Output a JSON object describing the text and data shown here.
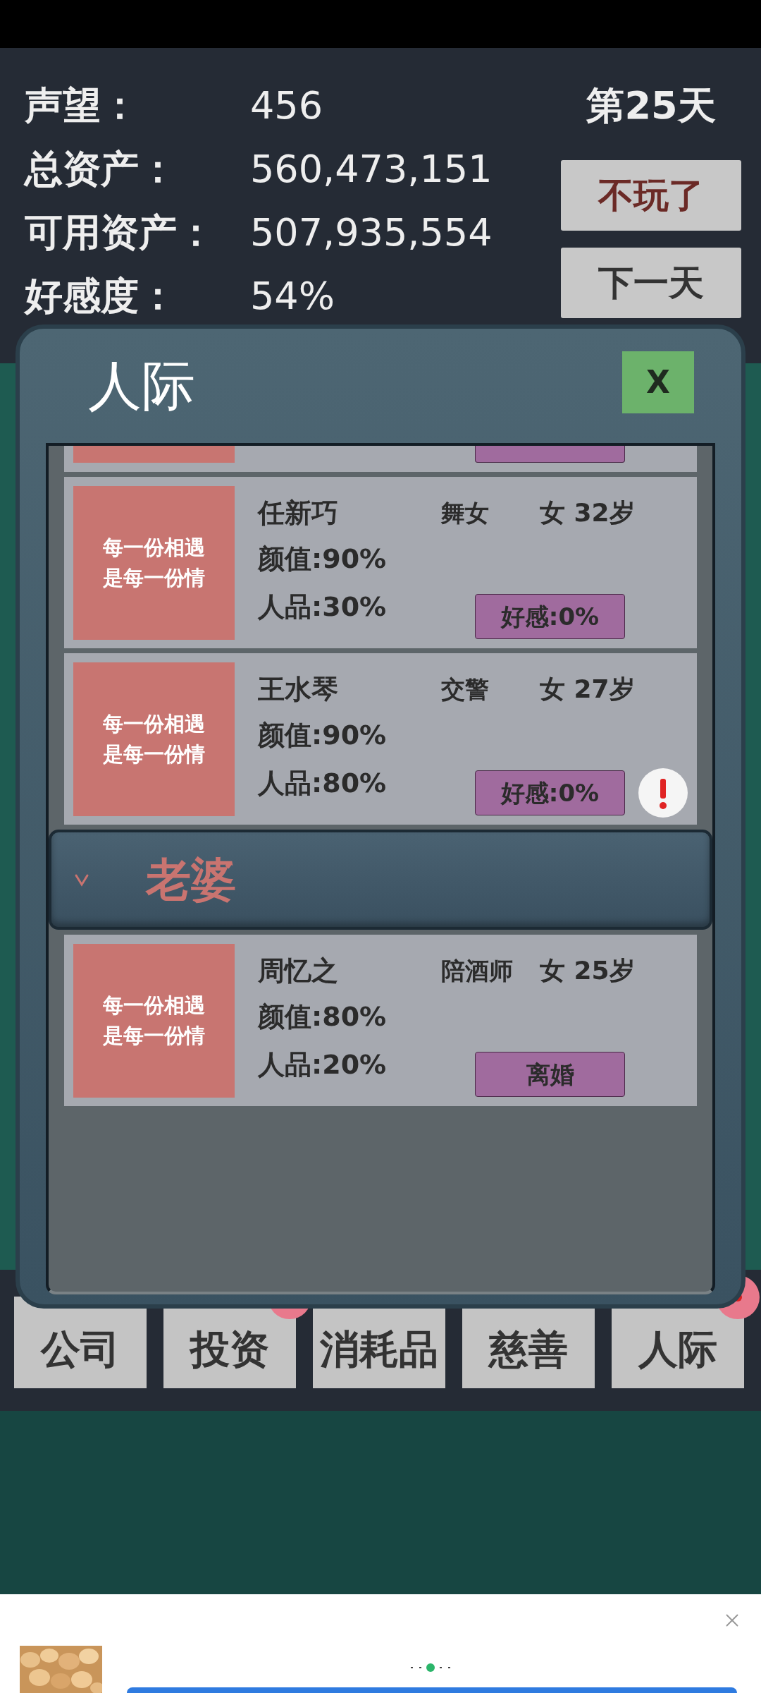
{
  "header": {
    "stats": [
      {
        "label": "声望：",
        "value": "456"
      },
      {
        "label": "总资产：",
        "value": "560,473,151"
      },
      {
        "label": "可用资产：",
        "value": "507,935,554"
      },
      {
        "label": "好感度：",
        "value": "54%"
      }
    ],
    "day": "第25天",
    "buttons": [
      {
        "label": "不玩了",
        "kind": "danger"
      },
      {
        "label": "下一天",
        "kind": "normal"
      }
    ]
  },
  "dialog": {
    "title": "人际",
    "close": "X",
    "entries": [
      {
        "kind": "partial"
      },
      {
        "kind": "card",
        "avatar_lines": [
          "每一份相遇",
          "是每一份情"
        ],
        "name": "任新巧",
        "job": "舞女",
        "gender_age": "女 32岁",
        "stats": [
          "颜值:90%",
          "人品:30%"
        ],
        "action": "好感:0%",
        "alert": false
      },
      {
        "kind": "card",
        "avatar_lines": [
          "每一份相遇",
          "是每一份情"
        ],
        "name": "王水琴",
        "job": "交警",
        "gender_age": "女 27岁",
        "stats": [
          "颜值:90%",
          "人品:80%"
        ],
        "action": "好感:0%",
        "alert": true
      },
      {
        "kind": "group",
        "label": "老婆",
        "expanded": true
      },
      {
        "kind": "card",
        "avatar_lines": [
          "每一份相遇",
          "是每一份情"
        ],
        "name": "周忆之",
        "job": "陪酒师",
        "gender_age": "女 25岁",
        "stats": [
          "颜值:80%",
          "人品:20%"
        ],
        "action": "离婚",
        "alert": false
      }
    ]
  },
  "nav": [
    {
      "label": "公司",
      "badge": false
    },
    {
      "label": "投资",
      "badge": true
    },
    {
      "label": "消耗品",
      "badge": false
    },
    {
      "label": "慈善",
      "badge": false
    },
    {
      "label": "人际",
      "badge": true
    }
  ]
}
